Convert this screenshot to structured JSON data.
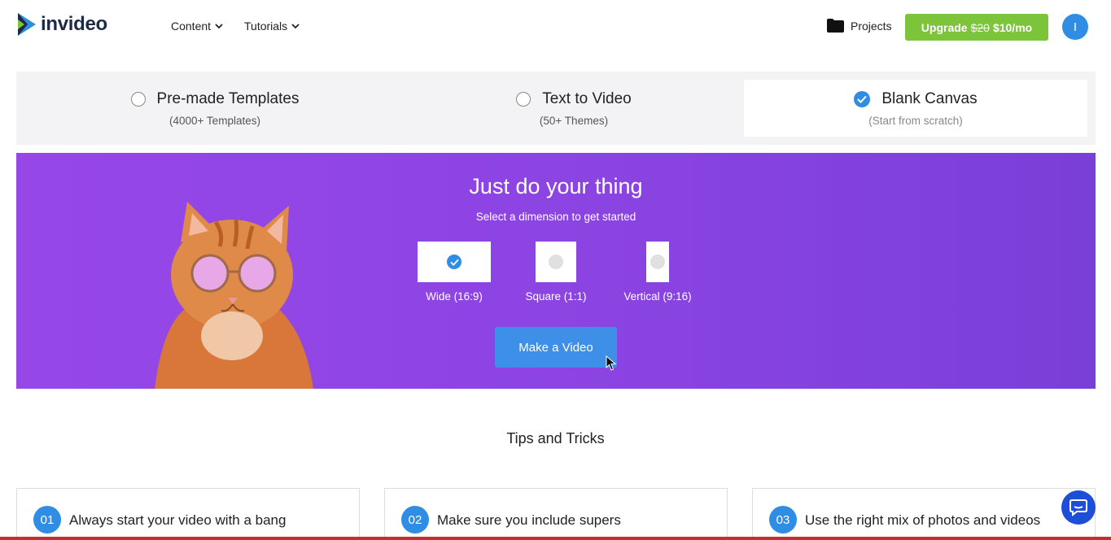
{
  "header": {
    "logo_text": "invideo",
    "nav": [
      {
        "label": "Content"
      },
      {
        "label": "Tutorials"
      }
    ],
    "projects_label": "Projects",
    "upgrade": {
      "prefix": "Upgrade",
      "old_price": "$20",
      "new_price": "$10/mo"
    },
    "avatar_initial": "I"
  },
  "modes": [
    {
      "title": "Pre-made Templates",
      "subtitle": "(4000+ Templates)",
      "selected": false
    },
    {
      "title": "Text to Video",
      "subtitle": "(50+ Themes)",
      "selected": false
    },
    {
      "title": "Blank Canvas",
      "subtitle": "(Start from scratch)",
      "selected": true
    }
  ],
  "hero": {
    "title": "Just do your thing",
    "subtitle": "Select a dimension to get started",
    "dimensions": [
      {
        "label": "Wide (16:9)",
        "selected": true
      },
      {
        "label": "Square (1:1)",
        "selected": false
      },
      {
        "label": "Vertical (9:16)",
        "selected": false
      }
    ],
    "cta_label": "Make a Video"
  },
  "tips": {
    "title": "Tips and Tricks",
    "items": [
      {
        "num": "01",
        "text": "Always start your video with a bang"
      },
      {
        "num": "02",
        "text": "Make sure you include supers"
      },
      {
        "num": "03",
        "text": "Use the right mix of photos and videos"
      }
    ]
  },
  "colors": {
    "accent_blue": "#2f8de4",
    "upgrade_green": "#7cc43a",
    "hero_purple": "#8c44e3"
  }
}
